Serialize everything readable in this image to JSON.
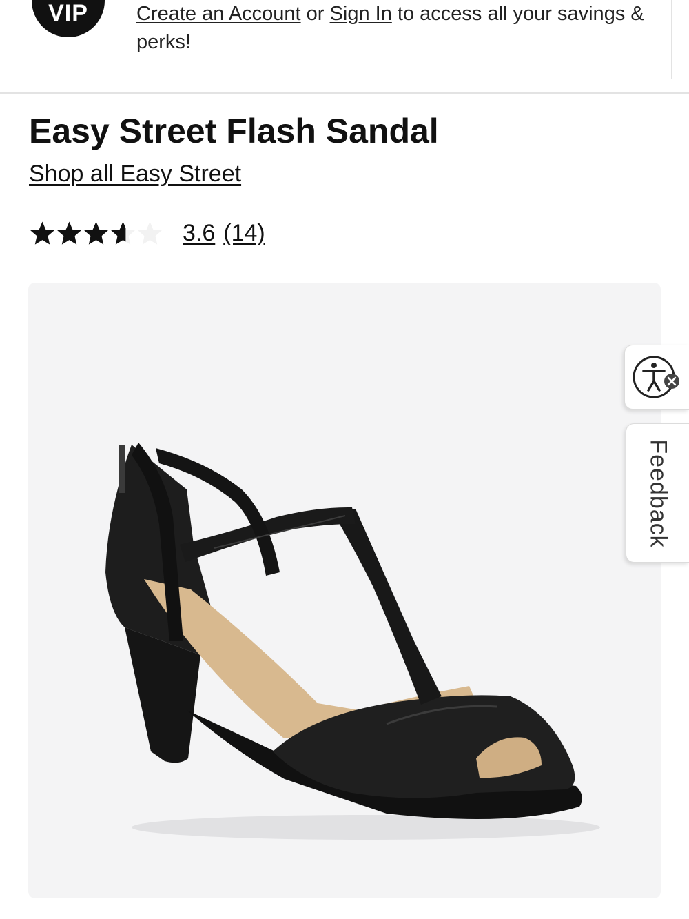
{
  "vip_banner": {
    "badge_text": "VIP",
    "create_account_link": "Create an Account",
    "or_text": "or",
    "sign_in_link": "Sign In",
    "message_tail": "to access all your savings & perks!"
  },
  "product": {
    "title": "Easy Street Flash Sandal",
    "shop_all_link": "Shop all Easy Street",
    "rating": {
      "value": "3.6",
      "count": "(14)",
      "stars_total": 5,
      "stars_filled": 3.6
    },
    "image_icon": "black-t-strap-peep-toe-heel-sandal"
  },
  "widgets": {
    "accessibility_icon": "accessibility-person-icon",
    "feedback_label": "Feedback"
  },
  "colors": {
    "text": "#111111",
    "image_background": "#f4f4f5",
    "border": "#e3e3e3",
    "star_empty": "#f2f2f2"
  }
}
